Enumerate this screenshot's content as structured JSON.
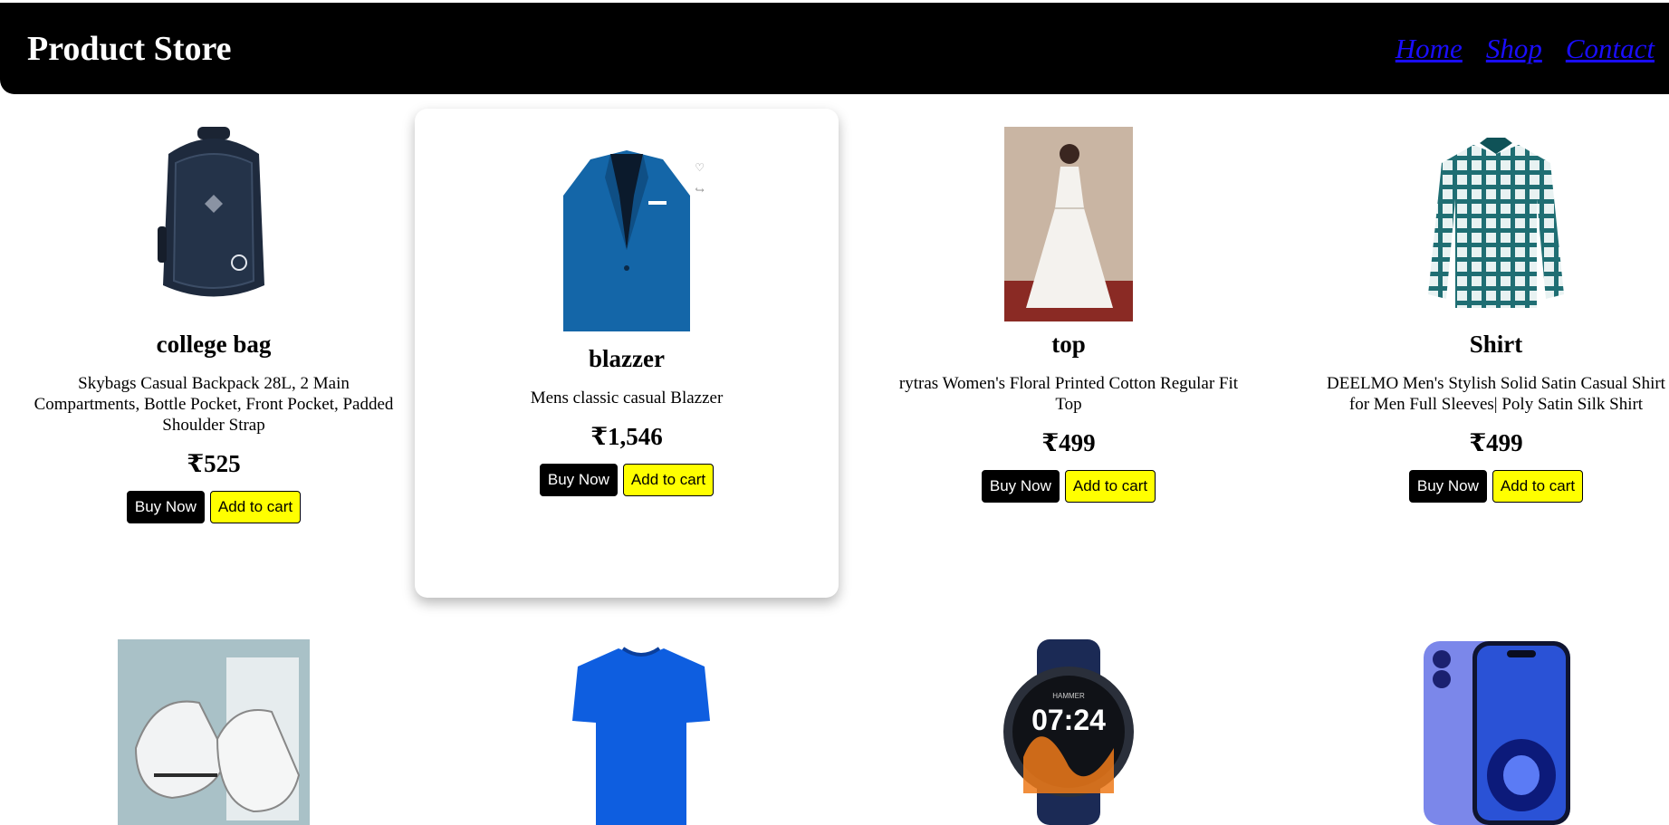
{
  "header": {
    "brand": "Product Store",
    "nav": [
      "Home",
      "Shop",
      "Contact"
    ]
  },
  "colors": {
    "header_bg": "#000000",
    "link": "#1a0dff",
    "buy_bg": "#000000",
    "cart_bg": "#ffff00"
  },
  "products": [
    {
      "name": "college bag",
      "description": "Skybags Casual Backpack 28L, 2 Main Compartments, Bottle Pocket, Front Pocket, Padded Shoulder Strap",
      "price": "₹525",
      "buy_label": "Buy Now",
      "cart_label": "Add to cart",
      "image_icon": "backpack-image"
    },
    {
      "name": "blazzer",
      "description": "Mens classic casual Blazzer",
      "price": "₹1,546",
      "buy_label": "Buy Now",
      "cart_label": "Add to cart",
      "image_icon": "blazer-image"
    },
    {
      "name": "top",
      "description": "rytras Women's Floral Printed Cotton Regular Fit Top",
      "price": "₹499",
      "buy_label": "Buy Now",
      "cart_label": "Add to cart",
      "image_icon": "dress-image"
    },
    {
      "name": "Shirt",
      "description": "DEELMO Men's Stylish Solid Satin Casual Shirt for Men Full Sleeves| Poly Satin Silk Shirt",
      "price": "₹499",
      "buy_label": "Buy Now",
      "cart_label": "Add to cart",
      "image_icon": "shirt-image"
    }
  ],
  "row2_images": [
    "sneakers-image",
    "tshirt-image",
    "smartwatch-image",
    "phone-image"
  ],
  "watch_text": {
    "brand": "HAMMER",
    "time": "07:24"
  }
}
